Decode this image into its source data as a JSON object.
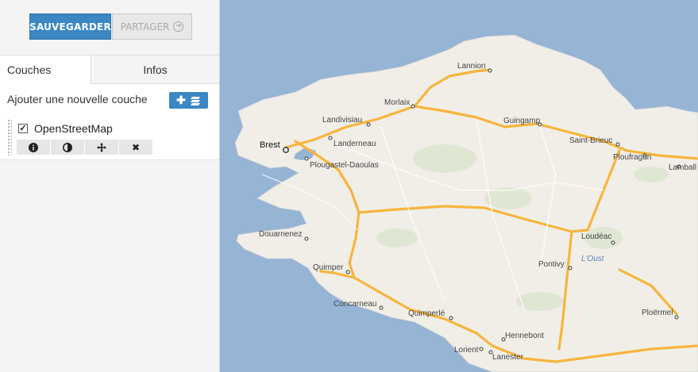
{
  "toolbar": {
    "save_label": "SAUVEGARDER",
    "share_label": "PARTAGER"
  },
  "tabs": [
    {
      "label": "Couches"
    },
    {
      "label": "Infos"
    }
  ],
  "layers_panel": {
    "add_label": "Ajouter une nouvelle couche",
    "layers": [
      {
        "name": "OpenStreetMap",
        "checked": true
      }
    ],
    "tools": [
      "info-icon",
      "contrast-icon",
      "move-icon",
      "close-icon"
    ]
  },
  "map": {
    "cities": [
      "Lannion",
      "Morlaix",
      "Landivisiau",
      "Guingamp",
      "Brest",
      "Landerneau",
      "Saint-Brieuc",
      "Plougastel-Daoulas",
      "Ploufragan",
      "Lamball",
      "Douarnenez",
      "Loudéac",
      "Quimper",
      "Pontivy",
      "L'Oust",
      "Concarneau",
      "Quimperlé",
      "Hennebont",
      "Ploërmel",
      "Lorient",
      "Lanester"
    ],
    "colors": {
      "sea": "#96b4d4",
      "land": "#f1eee8",
      "road": "#f7b53c"
    }
  }
}
